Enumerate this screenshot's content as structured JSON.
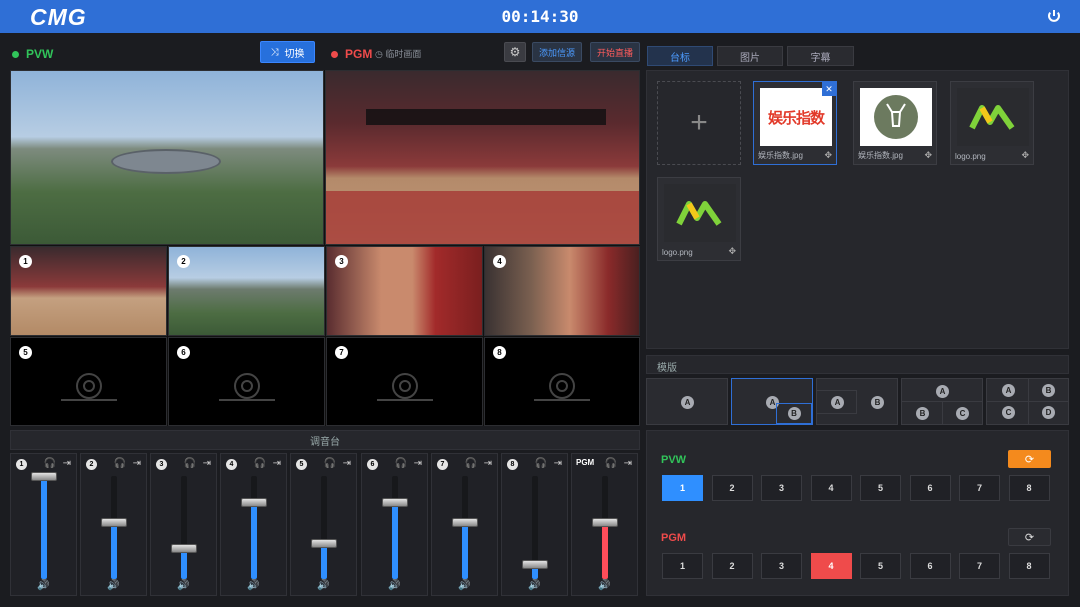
{
  "header": {
    "logo": "CMG",
    "clock": "00:14:30",
    "power_icon": "power-icon"
  },
  "left": {
    "pvw_label": "PVW",
    "switch_label": "切换",
    "pgm_label": "PGM",
    "temp_label": "临时画面",
    "add_source": "添加信源",
    "start_live": "开始直播"
  },
  "inputs": [
    "1",
    "2",
    "3",
    "4",
    "5",
    "6",
    "7",
    "8"
  ],
  "mixer": {
    "title": "调音台",
    "pgm_label": "PGM",
    "levels": [
      1.0,
      0.55,
      0.3,
      0.75,
      0.35,
      0.75,
      0.55,
      0.15,
      0.55
    ]
  },
  "tabs": [
    "台标",
    "图片",
    "字幕"
  ],
  "logos": [
    {
      "caption": "娱乐指数.jpg",
      "badge": "娱乐指数"
    },
    {
      "caption": "娱乐指数.jpg"
    },
    {
      "caption": "logo.png"
    },
    {
      "caption": "logo.png"
    }
  ],
  "template": {
    "title": "模版",
    "letters": [
      "A",
      "B",
      "C",
      "D"
    ]
  },
  "bus": {
    "pvw_label": "PVW",
    "pgm_label": "PGM",
    "pvw_selected": "1",
    "pgm_selected": "4",
    "buttons": [
      "1",
      "2",
      "3",
      "4",
      "5",
      "6",
      "7",
      "8"
    ]
  },
  "colors": {
    "accent": "#2f6fd6",
    "pvw": "#31c45a",
    "pgm": "#ef4b4b",
    "fader": "#2f8fff",
    "pgm_fader": "#ff4d5a",
    "orange": "#f48a1d"
  }
}
